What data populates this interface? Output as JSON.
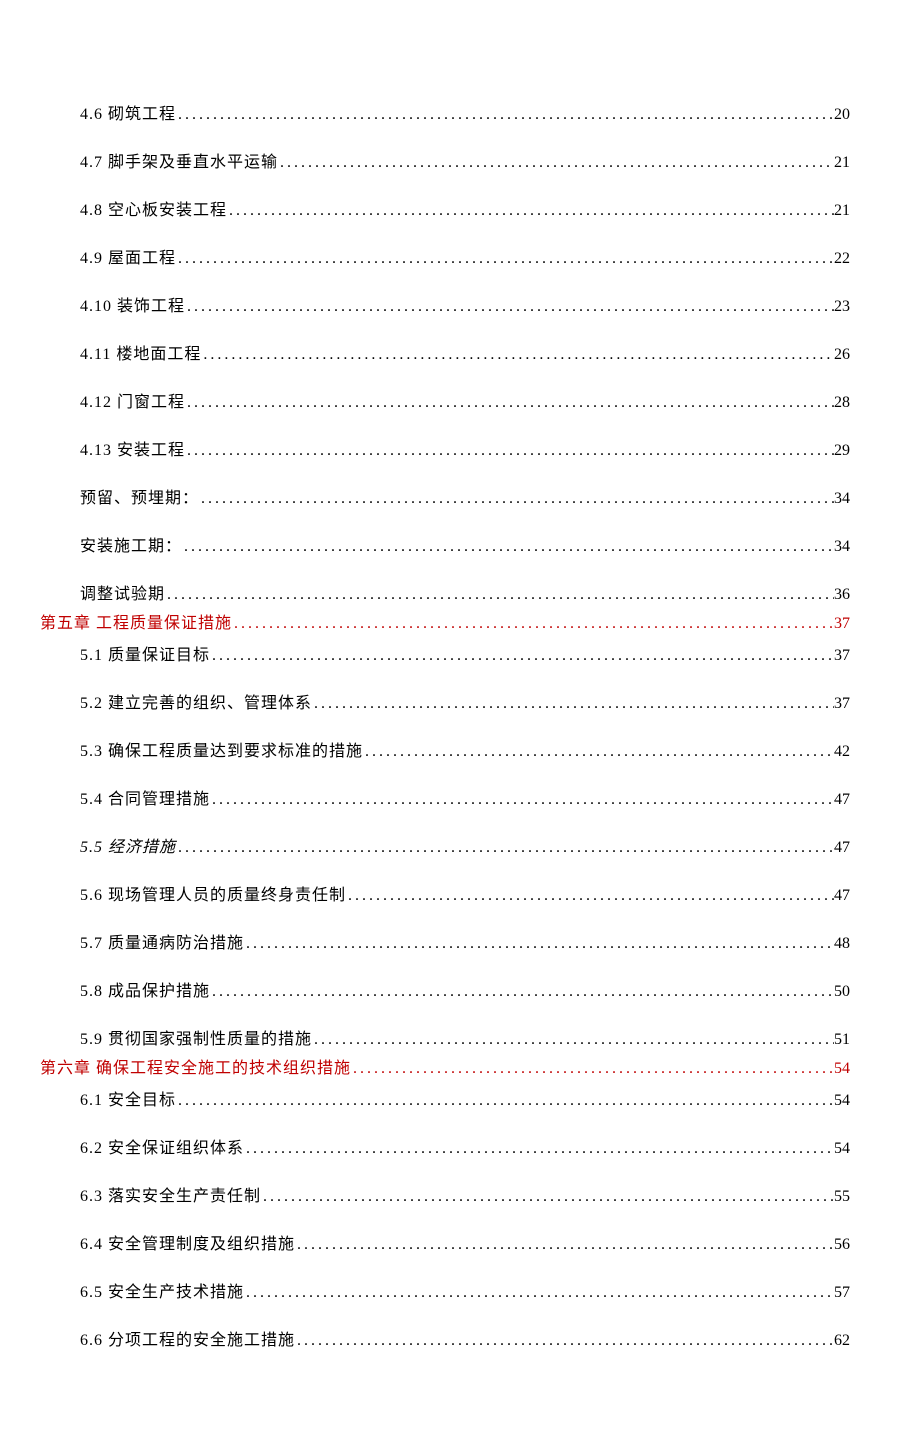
{
  "dots": "........................................................................................................................",
  "entries": [
    {
      "type": "sub",
      "label": "4.6 砌筑工程",
      "page": "20"
    },
    {
      "type": "sub",
      "label": "4.7 脚手架及垂直水平运输",
      "page": "21"
    },
    {
      "type": "sub",
      "label": "4.8 空心板安装工程",
      "page": "21"
    },
    {
      "type": "sub",
      "label": "4.9 屋面工程",
      "page": "22"
    },
    {
      "type": "sub",
      "label": "4.10 装饰工程",
      "page": "23"
    },
    {
      "type": "sub",
      "label": "4.11 楼地面工程",
      "page": "26"
    },
    {
      "type": "sub",
      "label": "4.12 门窗工程",
      "page": "28"
    },
    {
      "type": "sub",
      "label": "4.13 安装工程",
      "page": "29"
    },
    {
      "type": "sub",
      "label": "预留、预埋期：",
      "page": "34"
    },
    {
      "type": "sub",
      "label": "安装施工期：",
      "page": "34"
    },
    {
      "type": "sub-tight",
      "label": "调整试验期",
      "page": "36"
    },
    {
      "type": "chapter",
      "label": "第五章 工程质量保证措施",
      "page": "37"
    },
    {
      "type": "sub",
      "label": "5.1 质量保证目标",
      "page": "37"
    },
    {
      "type": "sub",
      "label": "5.2 建立完善的组织、管理体系",
      "page": "37"
    },
    {
      "type": "sub",
      "label": "5.3 确保工程质量达到要求标准的措施",
      "page": "42"
    },
    {
      "type": "sub",
      "label": "5.4 合同管理措施",
      "page": "47"
    },
    {
      "type": "sub",
      "label": "5.5 经济措施",
      "page": "47",
      "italic": true
    },
    {
      "type": "sub",
      "label": "5.6 现场管理人员的质量终身责任制",
      "page": "47"
    },
    {
      "type": "sub",
      "label": "5.7 质量通病防治措施",
      "page": "48"
    },
    {
      "type": "sub",
      "label": "5.8 成品保护措施",
      "page": "50"
    },
    {
      "type": "sub-tight",
      "label": "5.9 贯彻国家强制性质量的措施",
      "page": "51"
    },
    {
      "type": "chapter",
      "label": "第六章 确保工程安全施工的技术组织措施",
      "page": "54"
    },
    {
      "type": "sub",
      "label": "6.1 安全目标",
      "page": "54"
    },
    {
      "type": "sub",
      "label": "6.2 安全保证组织体系",
      "page": "54"
    },
    {
      "type": "sub",
      "label": "6.3 落实安全生产责任制",
      "page": "55"
    },
    {
      "type": "sub",
      "label": "6.4 安全管理制度及组织措施",
      "page": "56"
    },
    {
      "type": "sub",
      "label": "6.5 安全生产技术措施",
      "page": "57"
    },
    {
      "type": "sub",
      "label": "6.6 分项工程的安全施工措施",
      "page": "62"
    }
  ]
}
